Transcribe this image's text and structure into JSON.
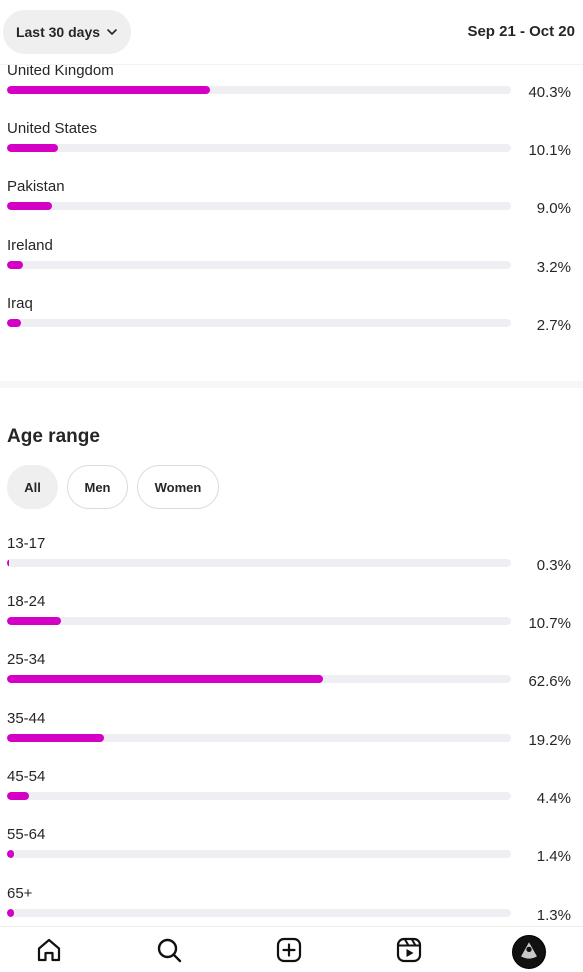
{
  "header": {
    "range_label": "Last 30 days",
    "date_span": "Sep 21 - Oct 20"
  },
  "countries": [
    {
      "label": "United Kingdom",
      "pct_text": "40.3%",
      "value": 40.3
    },
    {
      "label": "United States",
      "pct_text": "10.1%",
      "value": 10.1
    },
    {
      "label": "Pakistan",
      "pct_text": "9.0%",
      "value": 9.0
    },
    {
      "label": "Ireland",
      "pct_text": "3.2%",
      "value": 3.2
    },
    {
      "label": "Iraq",
      "pct_text": "2.7%",
      "value": 2.7
    }
  ],
  "age_section": {
    "title": "Age range",
    "filters": [
      {
        "label": "All",
        "active": true
      },
      {
        "label": "Men",
        "active": false
      },
      {
        "label": "Women",
        "active": false
      }
    ],
    "rows": [
      {
        "label": "13-17",
        "pct_text": "0.3%",
        "value": 0.3
      },
      {
        "label": "18-24",
        "pct_text": "10.7%",
        "value": 10.7
      },
      {
        "label": "25-34",
        "pct_text": "62.6%",
        "value": 62.6
      },
      {
        "label": "35-44",
        "pct_text": "19.2%",
        "value": 19.2
      },
      {
        "label": "45-54",
        "pct_text": "4.4%",
        "value": 4.4
      },
      {
        "label": "55-64",
        "pct_text": "1.4%",
        "value": 1.4
      },
      {
        "label": "65+",
        "pct_text": "1.3%",
        "value": 1.3
      }
    ]
  },
  "bar_scale_max": 100,
  "bottom_nav": [
    {
      "icon": "home-icon"
    },
    {
      "icon": "search-icon"
    },
    {
      "icon": "create-icon"
    },
    {
      "icon": "reels-icon"
    },
    {
      "icon": "profile-avatar"
    }
  ],
  "colors": {
    "bar_fill": "#d400c6",
    "bar_track": "#eeeef3",
    "text": "#262626"
  }
}
